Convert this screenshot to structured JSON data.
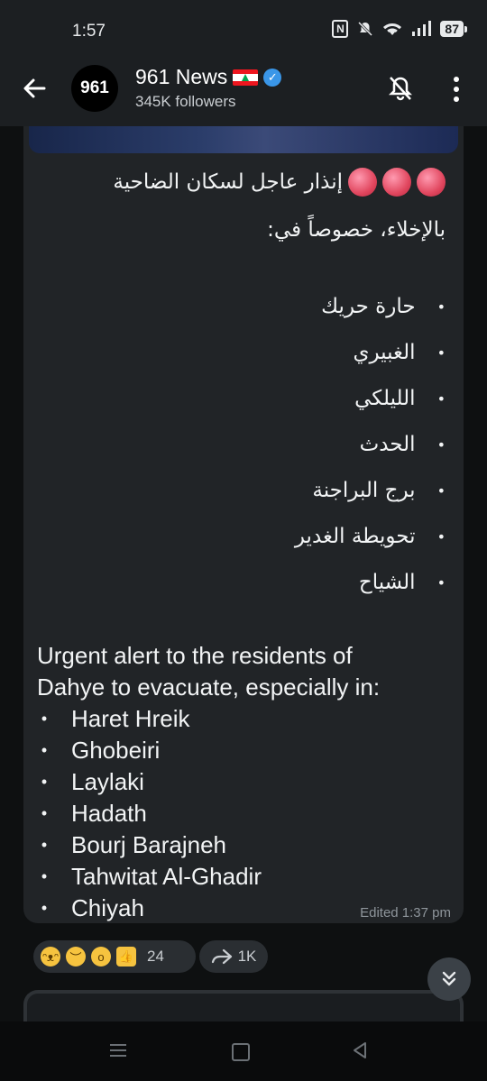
{
  "status_bar": {
    "time": "1:57",
    "battery": "87",
    "nfc": "N"
  },
  "header": {
    "avatar_text": "961",
    "channel_name": "961 News",
    "followers": "345K followers"
  },
  "message": {
    "arabic_title": "إنذار عاجل لسكان الضاحية",
    "arabic_subtitle": "بالإخلاء، خصوصاً في:",
    "arabic_places": [
      "حارة حريك",
      "الغبيري",
      "الليلكي",
      "الحدث",
      "برج البراجنة",
      "تحويطة الغدير",
      "الشياح"
    ],
    "english_line1": "Urgent alert to the residents of",
    "english_line2": "Dahye to evacuate, especially in:",
    "english_places": [
      "Haret Hreik",
      "Ghobeiri",
      "Laylaki",
      "Hadath",
      "Bourj Barajneh",
      "Tahwitat Al-Ghadir",
      "Chiyah"
    ],
    "edited": "Edited 1:37 pm",
    "bullet": "•"
  },
  "reactions": {
    "count": "24",
    "share_count": "1K"
  },
  "colors": {
    "bubble": "#212427",
    "header": "#1c1f22",
    "verified": "#3a96e8"
  }
}
